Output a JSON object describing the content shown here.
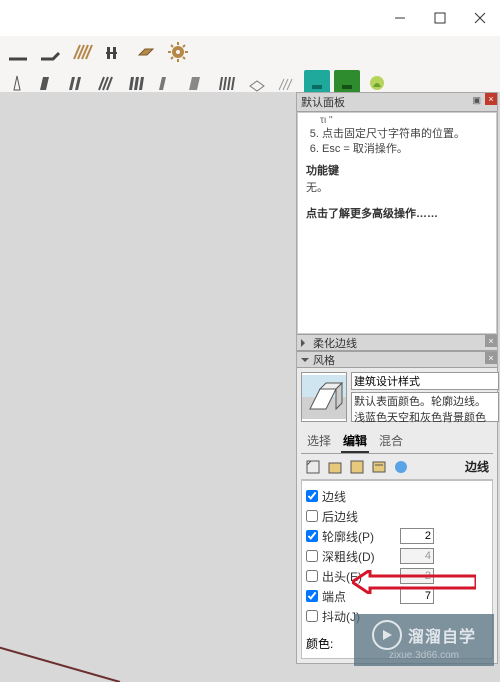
{
  "titlebar": {},
  "panel_title": "默认面板",
  "instructor": {
    "step5": "点击固定尺寸字符串的位置。",
    "step6": "Esc = 取消操作。",
    "func_keys_header": "功能键",
    "func_keys_text": "无。",
    "adv_link": "点击了解更多高级操作……"
  },
  "sections": {
    "soften": "柔化边线",
    "style": "风格"
  },
  "style": {
    "name": "建筑设计样式",
    "desc_line1": "默认表面颜色。轮廓边线。",
    "desc_line2": "浅蓝色天空和灰色背景颜色",
    "desc_line3": "。"
  },
  "tabs": {
    "select": "选择",
    "edit": "编辑",
    "mix": "混合"
  },
  "sub_label_right": "边线",
  "edges": {
    "edge": "边线",
    "back_edge": "后边线",
    "profile": "轮廓线(P)",
    "depth": "深粗线(D)",
    "ext": "出头(E)",
    "endpoints": "端点",
    "jitter": "抖动(J)",
    "vals": {
      "profile": "2",
      "depth": "4",
      "ext": "2",
      "endpoints": "7"
    },
    "checks": {
      "edge": true,
      "back_edge": false,
      "profile": true,
      "depth": false,
      "ext": false,
      "endpoints": true,
      "jitter": false
    }
  },
  "color_label": "颜色:",
  "watermark": {
    "title": "溜溜自学",
    "url": "zixue.3d66.com"
  }
}
